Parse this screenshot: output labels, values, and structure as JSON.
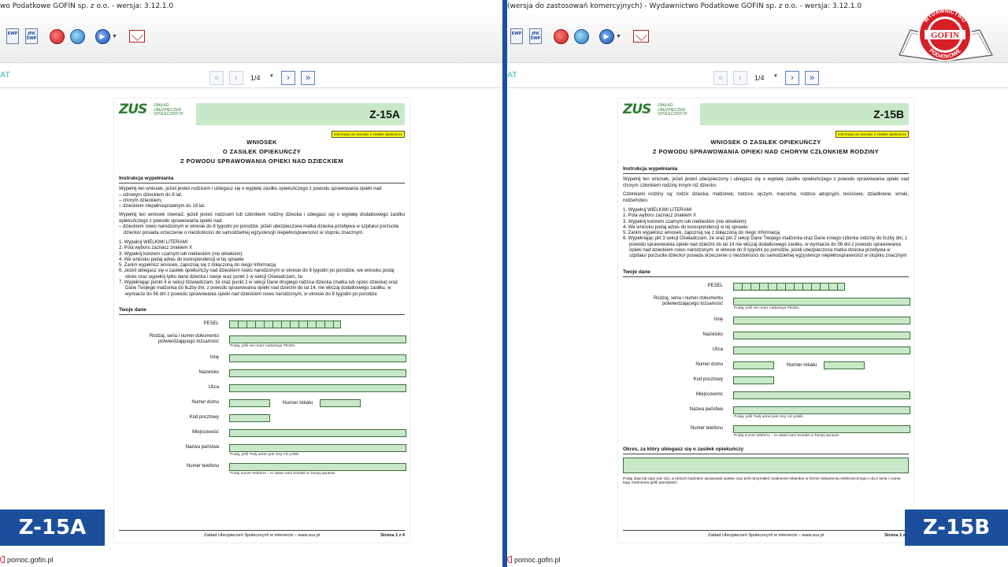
{
  "left": {
    "window_title": "wo Podatkowe GOFIN sp. z o.o. - wersja: 3.12.1.0",
    "toolbar": {
      "ewp": "EWP",
      "jpk_ewp": "JPK EWP"
    },
    "page_indicator": "1/4",
    "side_mark": "AT",
    "form": {
      "org": [
        "ZAKŁAD",
        "UBEZPIECZEŃ",
        "SPOŁECZNYCH"
      ],
      "logo": "ZUS",
      "code": "Z-15A",
      "info_tag": "Informacja do wniosku o zasiłek opiekuńczy",
      "title": [
        "WNIOSEK",
        "O ZASIŁEK OPIEKUŃCZY",
        "Z POWODU SPRAWOWANIA OPIEKI NAD DZIECKIEM"
      ],
      "instr_head": "Instrukcja wypełniania",
      "para1": "Wypełnij ten wniosek, jeżeli jesteś rodzicem i ubiegasz się o wypłatę zasiłku opiekuńczego z powodu sprawowania opieki nad:",
      "para1_items": [
        "–  zdrowym dzieckiem do 8 lat,",
        "–  chorym dzieckiem,",
        "–  dzieckiem niepełnosprawnym do 18 lat."
      ],
      "para2": "Wypełnij ten wniosek również, jeżeli jesteś rodzicem lub członkiem rodziny dziecka i ubiegasz się o wypłatę dodatkowego zasiłku opiekuńczego z powodu sprawowania opieki nad:",
      "para2_item": "–  dzieckiem nowo narodzonym w okresie do 8 tygodni po porodzie, jeżeli ubezpieczona matka dziecka przebywa w szpitalu/ porzuciła dziecko/ posiada orzeczenie o niezdolności do samodzielnej egzystencji/ niepełnosprawności w stopniu znacznym.",
      "steps": [
        "1.  Wypełnij WIELKIMI LITERAMI",
        "2.  Pola wyboru zaznacz znakiem X",
        "3.  Wypełnij kolorem czarnym lub niebieskim (nie ołówkiem)",
        "4.  We wniosku podaj adres do korespondencji w tej sprawie",
        "5.  Zanim wypełnisz wniosek, zapoznaj się z dołączoną do niego Informacją",
        "6.  Jeżeli ubiegasz się o zasiłek opiekuńczy nad dzieckiem nowo narodzonym w okresie do 8 tygodni po porodzie, we wniosku podaj okres oraz wypełnij tylko dane dziecka i swoje oraz punkt 1 w sekcji Oświadczam, że",
        "7.  Wypełniając punkt 4 w sekcji Oświadczam, że oraz punkt 2 w sekcji Dane drugiego rodzica dziecka (matka lub ojciec dziecka) oraz Dane Twojego małżonka do liczby dni, z powodu sprawowania opieki nad dziećmi do lat 14, nie wliczaj dodatkowego zasiłku, w wymiarze do 56 dni z powodu sprawowania opieki nad dzieckiem nowo narodzonym, w okresie do 8 tygodni po porodzie"
      ],
      "data_head": "Twoje dane",
      "fields": {
        "pesel": "PESEL",
        "doc": "Rodzaj, seria i numer dokumentu potwierdzającego tożsamość",
        "doc_hint": "Podaj, jeśli nie masz nadanego PESEL",
        "imie": "Imię",
        "nazwisko": "Nazwisko",
        "ulica": "Ulica",
        "nr_domu": "Numer domu",
        "nr_lokalu": "Numer lokalu",
        "kod": "Kod pocztowy",
        "miejscowosc": "Miejscowość",
        "panstwo": "Nazwa państwa",
        "panstwo_hint": "Podaj, jeśli Twój adres jest inny niż polski",
        "telefon": "Numer telefonu",
        "telefon_hint": "Podaj numer telefonu – to ułatwi nam kontakt w Twojej sprawie"
      },
      "footer": "Zakład Ubezpieczeń Społecznych w internecie – www.zus.pl",
      "page": "Strona 1 z 4"
    },
    "big_label": "Z-15A",
    "status": "pomoc.gofin.pl"
  },
  "right": {
    "window_title": "(wersja do zastosowań komercyjnych) - Wydawnictwo Podatkowe GOFIN sp. z o.o. - wersja: 3.12.1.0",
    "toolbar": {
      "ewp": "EWP",
      "jpk_ewp": "JPK EWP"
    },
    "page_indicator": "1/4",
    "side_mark": "AT",
    "form": {
      "org": [
        "ZAKŁAD",
        "UBEZPIECZEŃ",
        "SPOŁECZNYCH"
      ],
      "logo": "ZUS",
      "code": "Z-15B",
      "info_tag": "Informacja do wniosku o zasiłek opiekuńczy",
      "title": [
        "WNIOSEK O ZASIŁEK OPIEKUŃCZY",
        "Z POWODU SPRAWOWANIA OPIEKI NAD CHORYM CZŁONKIEM RODZINY"
      ],
      "instr_head": "Instrukcja wypełniania",
      "para1": "Wypełnij ten wniosek, jeżeli jesteś ubezpieczony i ubiegasz się o wypłatę zasiłku opiekuńczego z powodu sprawowania opieki nad chorym członkiem rodziny innym niż dziecko.",
      "para2": "Członkami rodziny są: rodzic dziecka, małżonek, rodzice, ojczym, macocha, rodzice adopcyjni, teściowie, dziadkowie, wnuki, rodzeństwo.",
      "steps": [
        "1.  Wypełnij WIELKIMI LITERAMI",
        "2.  Pola wyboru zaznacz znakiem X",
        "3.  Wypełnij kolorem czarnym lub niebieskim (nie ołówkiem)",
        "4.  We wniosku podaj adres do korespondencji w tej sprawie",
        "5.  Zanim wypełnisz wniosek, zapoznaj się z dołączoną do niego Informacją",
        "6.  Wypełniając pkt 3 sekcji Oświadczam, że oraz pkt 2 sekcji Dane Twojego małżonka oraz Dane innego członka rodziny do liczby dni, z powodu sprawowania opieki nad dziećmi do lat 14 nie wliczaj dodatkowego zasiłku, w wymiarze do 56 dni z powodu sprawowania opieki nad dzieckiem nowo narodzonym, w okresie do 8 tygodni po porodzie, jeżeli ubezpieczona matka dziecka przebywa w szpitalu/ porzuciła dziecko/ posiada orzeczenie o niezdolności do samodzielnej egzystencji/ niepełnosprawności w stopniu znacznym"
      ],
      "data_head": "Twoje dane",
      "fields": {
        "pesel": "PESEL",
        "doc": "Rodzaj, seria i numer dokumentu potwierdzającego tożsamość",
        "doc_hint": "Podaj, jeśli nie masz nadanego PESEL",
        "imie": "Imię",
        "nazwisko": "Nazwisko",
        "ulica": "Ulica",
        "nr_domu": "Numer domu",
        "nr_lokalu": "Numer lokalu",
        "kod": "Kod pocztowy",
        "miejscowosc": "Miejscowość",
        "panstwo": "Nazwa państwa",
        "panstwo_hint": "Podaj, jeśli Twój adres jest inny niż polski",
        "telefon": "Numer telefonu",
        "telefon_hint": "Podaj numer telefonu – to ułatwi nam kontakt w Twojej sprawie"
      },
      "okres_head": "Okres, za który ubiegasz się o zasiłek opiekuńczy",
      "okres_hint": "Podaj datę lub daty (od–do), w których będziesz sprawował opiekę oraz jeśli otrzymałeś zwolnienie lekarskie w formie dokumentu elektronicznego e-ZLA serię i numer tego zwolnienia (jeśli pamiętasz)",
      "footer": "Zakład Ubezpieczeń Społecznych w internecie – www.zus.pl",
      "page": "Strona 1 z 4"
    },
    "big_label": "Z-15B",
    "status": "pomoc.gofin.pl"
  },
  "gofin_logo": {
    "top": "WYDAWNICTWO",
    "name": "GOFIN",
    "bottom": "PODATKOWE"
  },
  "colors": {
    "accent": "#1b4f9b",
    "form_green": "#c9e8c9",
    "info_yellow": "#ffff00"
  }
}
